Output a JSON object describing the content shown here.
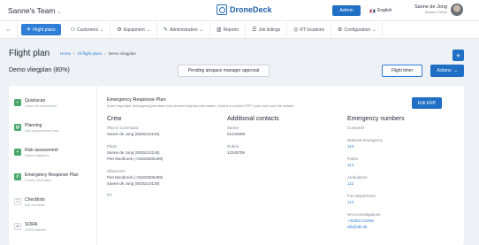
{
  "header": {
    "team": "Sanne's Team",
    "logo": "DroneDeck",
    "admin_label": "Admin",
    "language": "English",
    "user_name": "Sanne de Jong",
    "user_team": "Sanne's Team"
  },
  "nav": {
    "items": [
      {
        "label": "Flight plans",
        "icon": "plane-icon"
      },
      {
        "label": "Customers",
        "icon": "people-icon"
      },
      {
        "label": "Equipment",
        "icon": "gear-icon"
      },
      {
        "label": "Administration",
        "icon": "wrench-icon"
      },
      {
        "label": "Reports",
        "icon": "chart-icon"
      },
      {
        "label": "Job listings",
        "icon": "list-icon"
      },
      {
        "label": "RT locations",
        "icon": "target-icon"
      },
      {
        "label": "Configuration",
        "icon": "cog-icon"
      }
    ]
  },
  "page": {
    "title": "Flight plan",
    "breadcrumb": [
      "Home",
      "All flight plans",
      "Demo vliegplan"
    ],
    "plan_name": "Demo vliegplan (80%)",
    "pending_label": "Pending airspace manager approval",
    "timer_label": "Flight timer",
    "actions_label": "Actions"
  },
  "steps": [
    {
      "title": "Quickscan",
      "sub": "Check the environment",
      "done": true
    },
    {
      "title": "Planning",
      "sub": "Add equipment and crew",
      "done": true
    },
    {
      "title": "Risk assessment",
      "sub": "Define mitigations",
      "done": true
    },
    {
      "title": "Emergency Response Plan",
      "sub": "Contact information",
      "done": true
    },
    {
      "title": "Checklists",
      "sub": "Add checklists",
      "done": false
    },
    {
      "title": "SORA",
      "sub": "SORA outcome",
      "done": false
    }
  ],
  "erp": {
    "title": "Emergency Response Plan",
    "subtitle": "Enter important (emergency)numbers and closest hospital information. Select a custom ERP if you don't use the default.",
    "edit_label": "Edit ERP",
    "crew": {
      "heading": "Crew",
      "pic_label": "Pilot in Command",
      "pic_value": "Sanne de Jong (0625210128)",
      "pilots_label": "Pilots",
      "pilots": [
        "Sanne de Jong (0625210128)",
        "Piet Moobroek (+31625006499)"
      ],
      "observers_label": "Observers",
      "observers": [
        "Piet Moobroek (+31625006499)",
        "Sanne de Jong (0625210128)"
      ],
      "rt_label": "RT"
    },
    "contacts": {
      "heading": "Additional contacts",
      "items": [
        {
          "name": "Sanne",
          "phone": "01234669"
        },
        {
          "name": "Ruben",
          "phone": "12345789"
        }
      ]
    },
    "emergency": {
      "heading": "Emergency numbers",
      "customer_label": "Customer",
      "items": [
        {
          "label": "National emergency",
          "value": "112"
        },
        {
          "label": "Police",
          "value": "114"
        },
        {
          "label": "Ambulance",
          "value": "112"
        },
        {
          "label": "Fire department",
          "value": "112"
        },
        {
          "label": "NAA investigations",
          "value": "+45381711066"
        },
        {
          "label": "",
          "value": "alb@alb.dk"
        }
      ]
    }
  }
}
